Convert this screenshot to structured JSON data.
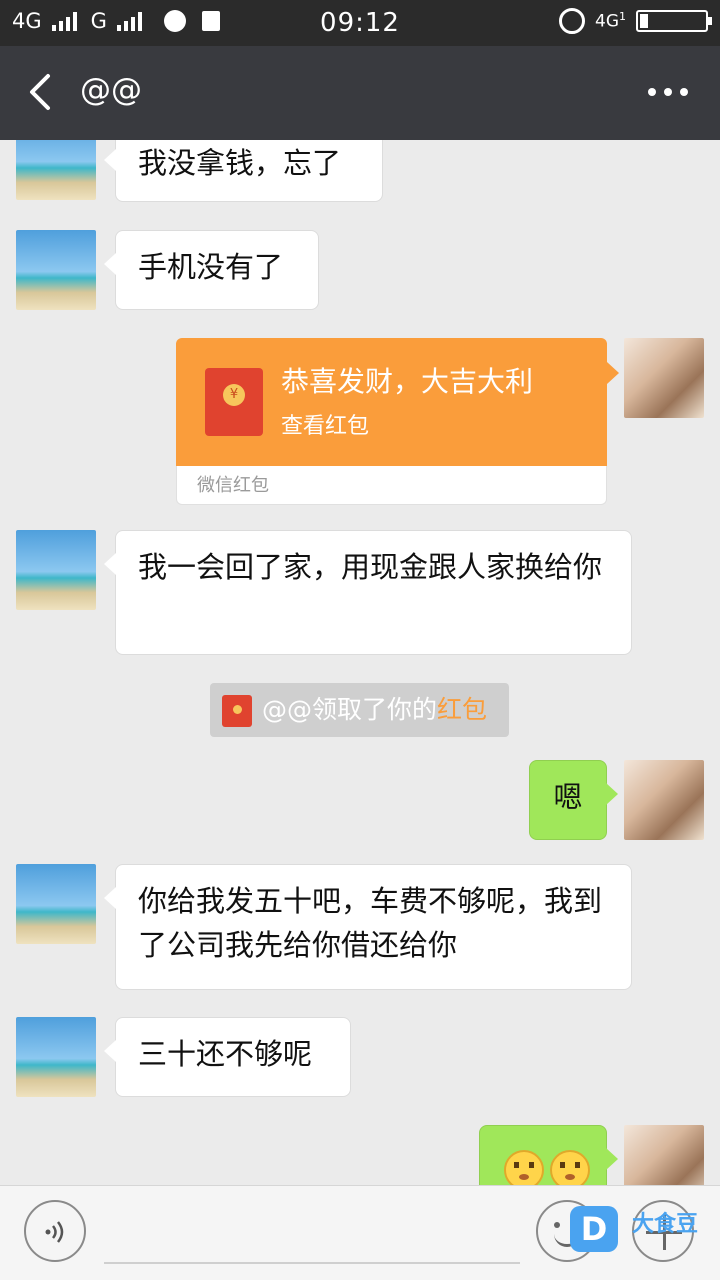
{
  "status_bar": {
    "network1": "4G",
    "network2": "G",
    "time": "09:12",
    "right_network": "4G",
    "right_network_sub": "1"
  },
  "header": {
    "title": "@@"
  },
  "messages": [
    {
      "side": "in",
      "text": "我没拿钱，忘了"
    },
    {
      "side": "in",
      "text": "手机没有了"
    },
    {
      "side": "out",
      "type": "red_packet",
      "greeting": "恭喜发财，大吉大利",
      "action": "查看红包",
      "footer": "微信红包",
      "coin": "¥"
    },
    {
      "side": "in",
      "text": "我一会回了家，用现金跟人家换给你"
    },
    {
      "type": "system",
      "prefix": "@@领取了你的",
      "highlight": "红包"
    },
    {
      "side": "out",
      "text": "嗯"
    },
    {
      "side": "in",
      "text": "你给我发五十吧，车费不够呢，我到了公司我先给你借还给你"
    },
    {
      "side": "in",
      "text": "三十还不够呢"
    },
    {
      "side": "out",
      "type": "emoji",
      "emojis": [
        "flushed-face",
        "flushed-face"
      ]
    }
  ],
  "watermark": {
    "badge": "D",
    "text": "大食豆"
  },
  "colors": {
    "status_bar": "#2b2b2b",
    "title_bar": "#393a3f",
    "chat_bg": "#ebebeb",
    "outgoing_bubble": "#a0e75a",
    "red_packet": "#fa9d3b",
    "red_packet_envelope": "#e0432f"
  }
}
